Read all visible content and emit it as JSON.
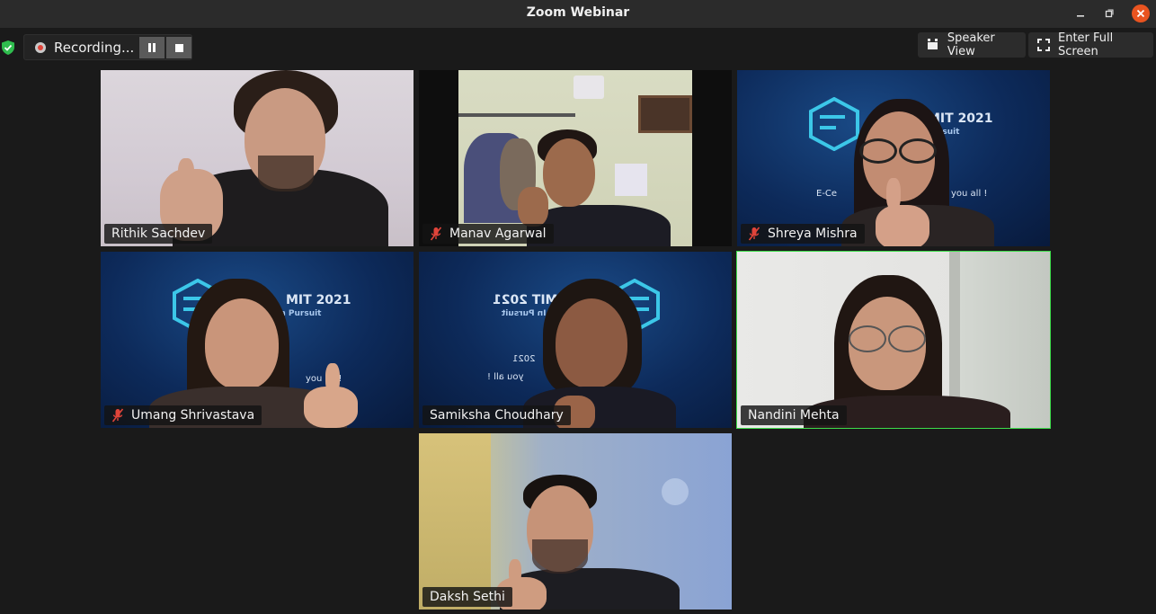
{
  "window": {
    "title": "Zoom Webinar",
    "minimize_icon": "minimize-icon",
    "maximize_icon": "restore-icon",
    "close_icon": "close-icon",
    "close_color": "#e95420"
  },
  "toolbar": {
    "security_icon": "shield-check-icon",
    "recording_label": "Recording...",
    "pause_icon": "pause-icon",
    "stop_icon": "stop-icon",
    "speaker_view_label": "Speaker View",
    "full_screen_label": "Enter Full Screen"
  },
  "participants": [
    {
      "name": "Rithik Sachdev",
      "muted": false,
      "active_speaker": false
    },
    {
      "name": "Manav Agarwal",
      "muted": true,
      "active_speaker": false
    },
    {
      "name": "Shreya Mishra",
      "muted": true,
      "active_speaker": false
    },
    {
      "name": "Umang Shrivastava",
      "muted": true,
      "active_speaker": false
    },
    {
      "name": "Samiksha Choudhary",
      "muted": false,
      "active_speaker": false
    },
    {
      "name": "Nandini Mehta",
      "muted": false,
      "active_speaker": true
    },
    {
      "name": "Daksh Sethi",
      "muted": false,
      "active_speaker": false
    }
  ],
  "virtual_background": {
    "line1": "MIT 2021",
    "line2": "In Pursuit",
    "line3": "2021",
    "line4": "you all !",
    "line5": "E-Ce"
  },
  "colors": {
    "active_border": "#3ddc4a",
    "muted_icon": "#e0443a",
    "background": "#1a1a1a"
  }
}
